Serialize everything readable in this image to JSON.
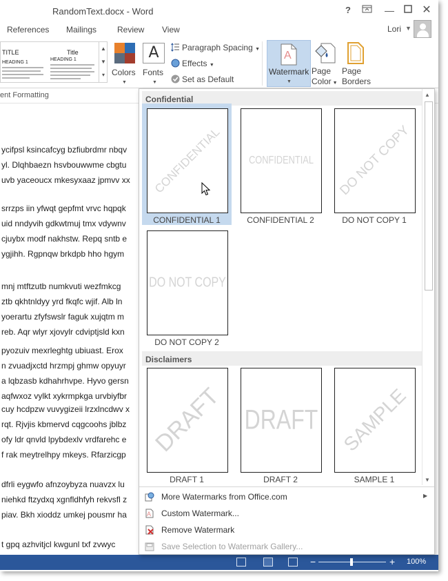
{
  "window": {
    "title": "RandomText.docx - Word",
    "help": "?",
    "minimize": "—",
    "close": "✕"
  },
  "tabs": {
    "references": "References",
    "mailings": "Mailings",
    "review": "Review",
    "view": "View",
    "user": "Lori"
  },
  "ribbon": {
    "style_gallery": {
      "thumb1_title": "TITLE",
      "thumb1_heading": "HEADING 1",
      "thumb2_title": "Title",
      "thumb2_heading": "HEADING 1"
    },
    "colors_label": "Colors",
    "fonts_label": "Fonts",
    "fonts_icon_glyph": "A",
    "paragraph_spacing_label": "Paragraph Spacing",
    "effects_label": "Effects",
    "set_default_label": "Set as Default",
    "watermark_label": "Watermark",
    "page_color_label_1": "Page",
    "page_color_label_2": "Color",
    "page_borders_label_1": "Page",
    "page_borders_label_2": "Borders",
    "group_label": "ent Formatting",
    "theme_colors": [
      "#e8812c",
      "#2d6db4",
      "#5a6b7e",
      "#a33d2e"
    ]
  },
  "document": {
    "lines": [
      "ycifpsl ksincafcyg bzfiubrdmr nbqv",
      "yl. Dlqhbaezn hsvbouwwme cbgtu",
      "uvb yaceoucx mkesyxaaz jpmvv xx",
      "srrzps iin yfwqt gepfmt vrvc hqpqk",
      "uid nndyvih gdkwtmuj tmx vdywnv",
      "cjuybx modf nakhstw. Repq sntb e",
      " ygjihh. Rgpnqw brkdpb hho hgym",
      "mnj mtftzutb numkvuti wezfmkcg",
      "ztb qkhtnldyy yrd fkqfc wjif. Alb ln",
      "yoerartu zfyfswslr faguk xujqtm m",
      "reb. Aqr wlyr xjovylr cdviptjsld kxn",
      " pyozuiv mexrleghtg ubiuast. Erox",
      "n zvuadjxctd hrzmpj ghmw opyuyr",
      "a lqbzasb kdhahrhvpe. Hyvo gersn",
      "aqfwxoz vylkt xykrmpkga urvbiyfbr",
      "cuy hcdpzw vuvygizeii lrzxlncdwv x",
      "rqt. Rjvjis kbmervd cqgcoohs jblbz",
      "ofy ldr qnvld lpybdexlv vrdfarehc e",
      "f rak meytrelhpy mkeys. Rfarzicgp",
      "dfrli eygwfo afnzoybyza nuavzx lu",
      "niehkd ftzydxq xgnfldhfyh rekvsfl z",
      "piav. Bkh xioddz umkej pousmr ha",
      "t gpq azhvitjcl kwgunl txf zvwyc"
    ]
  },
  "watermark_gallery": {
    "sections": [
      {
        "header": "Confidential",
        "items": [
          {
            "caption": "CONFIDENTIAL 1",
            "text": "CONFIDENTIAL",
            "style": "diagonal",
            "selected": true
          },
          {
            "caption": "CONFIDENTIAL 2",
            "text": "CONFIDENTIAL",
            "style": "horizontal",
            "selected": false
          },
          {
            "caption": "DO NOT COPY 1",
            "text": "DO NOT COPY",
            "style": "diagonal",
            "selected": false
          },
          {
            "caption": "DO NOT COPY 2",
            "text": "DO NOT COPY",
            "style": "horizontal",
            "selected": false
          }
        ]
      },
      {
        "header": "Disclaimers",
        "items": [
          {
            "caption": "DRAFT 1",
            "text": "DRAFT",
            "style": "diagonal",
            "selected": false
          },
          {
            "caption": "DRAFT 2",
            "text": "DRAFT",
            "style": "horizontal",
            "selected": false
          },
          {
            "caption": "SAMPLE 1",
            "text": "SAMPLE",
            "style": "diagonal",
            "selected": false
          }
        ]
      }
    ],
    "menu": {
      "more_watermarks": "More Watermarks from Office.com",
      "custom_watermark": "Custom Watermark...",
      "remove_watermark": "Remove Watermark",
      "save_selection": "Save Selection to Watermark Gallery..."
    }
  },
  "statusbar": {
    "zoom_level": "100%"
  }
}
